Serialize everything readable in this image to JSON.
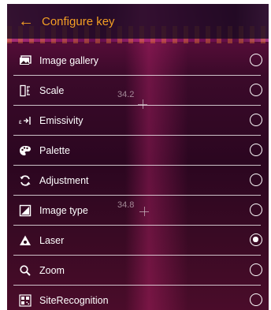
{
  "header": {
    "back_icon": "arrow-left-icon",
    "title": "Configure key"
  },
  "menu": {
    "items": [
      {
        "label": "Image gallery",
        "icon": "image-gallery-icon",
        "selected": false
      },
      {
        "label": "Scale",
        "icon": "scale-icon",
        "selected": false
      },
      {
        "label": "Emissivity",
        "icon": "emissivity-icon",
        "selected": false
      },
      {
        "label": "Palette",
        "icon": "palette-icon",
        "selected": false
      },
      {
        "label": "Adjustment",
        "icon": "adjustment-icon",
        "selected": false
      },
      {
        "label": "Image type",
        "icon": "image-type-icon",
        "selected": false
      },
      {
        "label": "Laser",
        "icon": "laser-icon",
        "selected": true
      },
      {
        "label": "Zoom",
        "icon": "zoom-icon",
        "selected": false
      },
      {
        "label": "SiteRecognition",
        "icon": "site-recognition-icon",
        "selected": false
      }
    ]
  },
  "overlay": {
    "temp1": "34.2",
    "temp2": "34.8"
  },
  "colors": {
    "accent": "#f4a023",
    "text": "#ffffff"
  }
}
